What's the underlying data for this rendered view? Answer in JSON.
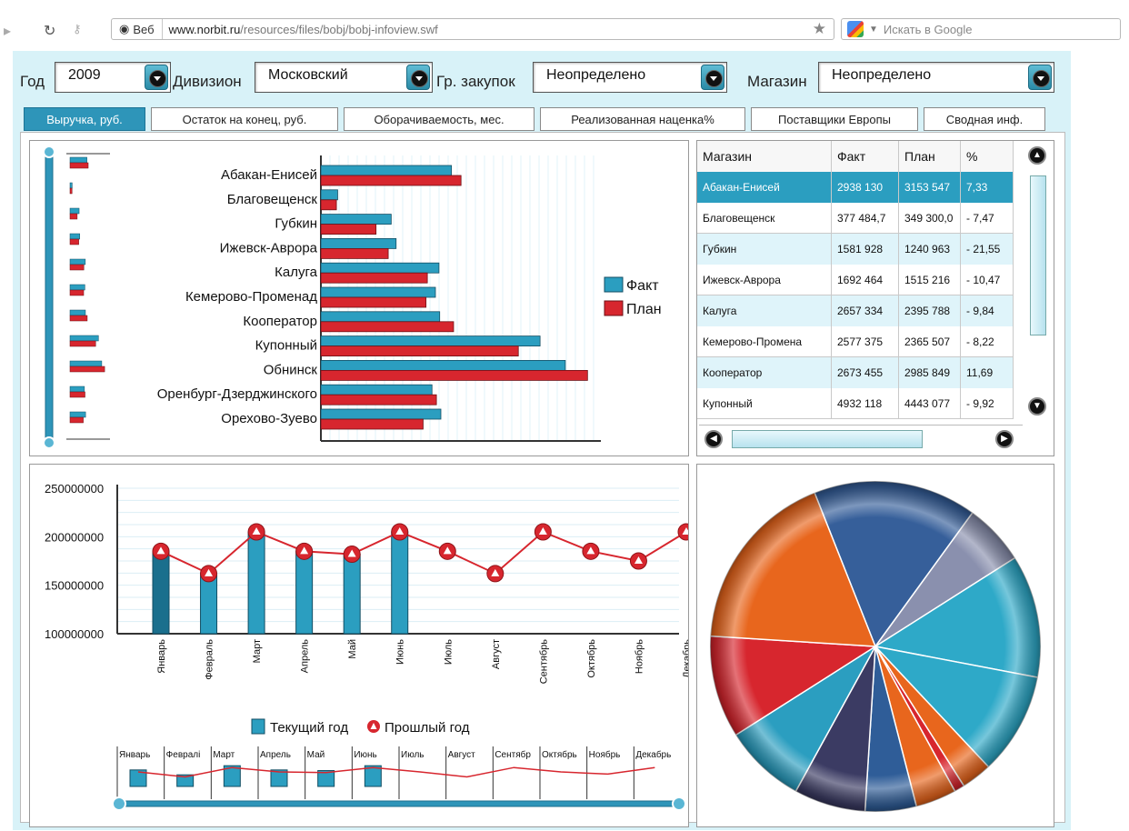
{
  "browser": {
    "site_label": "Веб",
    "url_host": "www.norbit.ru",
    "url_path": "/resources/files/bobj/bobj-infoview.swf",
    "search_placeholder": "Искать в Google"
  },
  "filters": [
    {
      "label": "Год",
      "value": "2009"
    },
    {
      "label": "Дивизион",
      "value": "Московский"
    },
    {
      "label": "Гр. закупок",
      "value": "Неопределено"
    },
    {
      "label": "Магазин",
      "value": "Неопределено"
    }
  ],
  "tabs": [
    {
      "label": "Выручка, руб.",
      "active": true
    },
    {
      "label": "Остаток на конец, руб.",
      "active": false
    },
    {
      "label": "Оборачиваемость, мес.",
      "active": false
    },
    {
      "label": "Реализованная наценка%",
      "active": false
    },
    {
      "label": "Поставщики Европы",
      "active": false
    },
    {
      "label": "Сводная инф.",
      "active": false
    }
  ],
  "store_table": {
    "columns": [
      "Магазин",
      "Факт",
      "План",
      "%"
    ],
    "rows": [
      [
        "Абакан-Енисей",
        "2938 130",
        "3153 547",
        "7,33"
      ],
      [
        "Благовещенск",
        "377 484,7",
        "349 300,0",
        "- 7,47"
      ],
      [
        "Губкин",
        "1581 928",
        "1240 963",
        "- 21,55"
      ],
      [
        "Ижевск-Аврора",
        "1692 464",
        "1515 216",
        "- 10,47"
      ],
      [
        "Калуга",
        "2657 334",
        "2395 788",
        "- 9,84"
      ],
      [
        "Кемерово-Промена",
        "2577 375",
        "2365 507",
        "- 8,22"
      ],
      [
        "Кооператор",
        "2673 455",
        "2985 849",
        "11,69"
      ],
      [
        "Купонный",
        "4932 118",
        "4443 077",
        "- 9,92"
      ]
    ],
    "selected_row": 0
  },
  "colors": {
    "fact": "#2b9ec0",
    "plan": "#d7262e",
    "accent": "#2e95b9"
  },
  "chart_data": [
    {
      "type": "bar",
      "orientation": "horizontal",
      "categories": [
        "Абакан-Енисей",
        "Благовещенск",
        "Губкин",
        "Ижевск-Аврора",
        "Калуга",
        "Кемерово-Променад",
        "Кооператор",
        "Купонный",
        "Обнинск",
        "Оренбург-Дзерджинского",
        "Орехово-Зуево"
      ],
      "series": [
        {
          "name": "Факт",
          "values": [
            2938130,
            377485,
            1581928,
            1692464,
            2657334,
            2577375,
            2673455,
            4932118,
            5500000,
            2500000,
            2700000
          ]
        },
        {
          "name": "План",
          "values": [
            3153547,
            349300,
            1240963,
            1515216,
            2395788,
            2365507,
            2985849,
            4443077,
            6000000,
            2600000,
            2300000
          ]
        }
      ],
      "xlim": [
        0,
        6300000
      ],
      "legend": "right"
    },
    {
      "type": "bar",
      "categories": [
        "Январь",
        "Февраль",
        "Март",
        "Апрель",
        "Май",
        "Июнь",
        "Июль",
        "Август",
        "Сентябрь",
        "Октябрь",
        "Ноябрь",
        "Декабрь"
      ],
      "series": [
        {
          "name": "Текущий год",
          "type": "bar",
          "values": [
            185000000,
            162000000,
            205000000,
            185000000,
            182000000,
            205000000,
            null,
            null,
            null,
            null,
            null,
            null
          ]
        },
        {
          "name": "Прошлый год",
          "type": "line",
          "values": [
            185000000,
            162000000,
            205000000,
            185000000,
            182000000,
            205000000,
            185000000,
            162000000,
            205000000,
            185000000,
            175000000,
            205000000
          ]
        }
      ],
      "yticks": [
        "100000000",
        "150000000",
        "200000000",
        "250000000"
      ],
      "ylim": [
        100000000,
        250000000
      ],
      "legend": "bottom",
      "overview_labels": [
        "Январь",
        "Февралі",
        "Март",
        "Апрель",
        "Май",
        "Июнь",
        "Июль",
        "Август",
        "Сентябр",
        "Октябрь",
        "Ноябрь",
        "Декабрь"
      ]
    },
    {
      "type": "pie",
      "values": [
        16,
        6,
        12,
        10,
        3,
        1,
        4,
        5,
        7,
        8,
        10,
        18
      ],
      "colors": [
        "#365f9a",
        "#8a90ae",
        "#2ea9c8",
        "#2ea9c8",
        "#e8661d",
        "#d7262e",
        "#e8661d",
        "#2f5d98",
        "#3b3b63",
        "#2b9ec0",
        "#d7262e",
        "#e8661d"
      ]
    }
  ]
}
